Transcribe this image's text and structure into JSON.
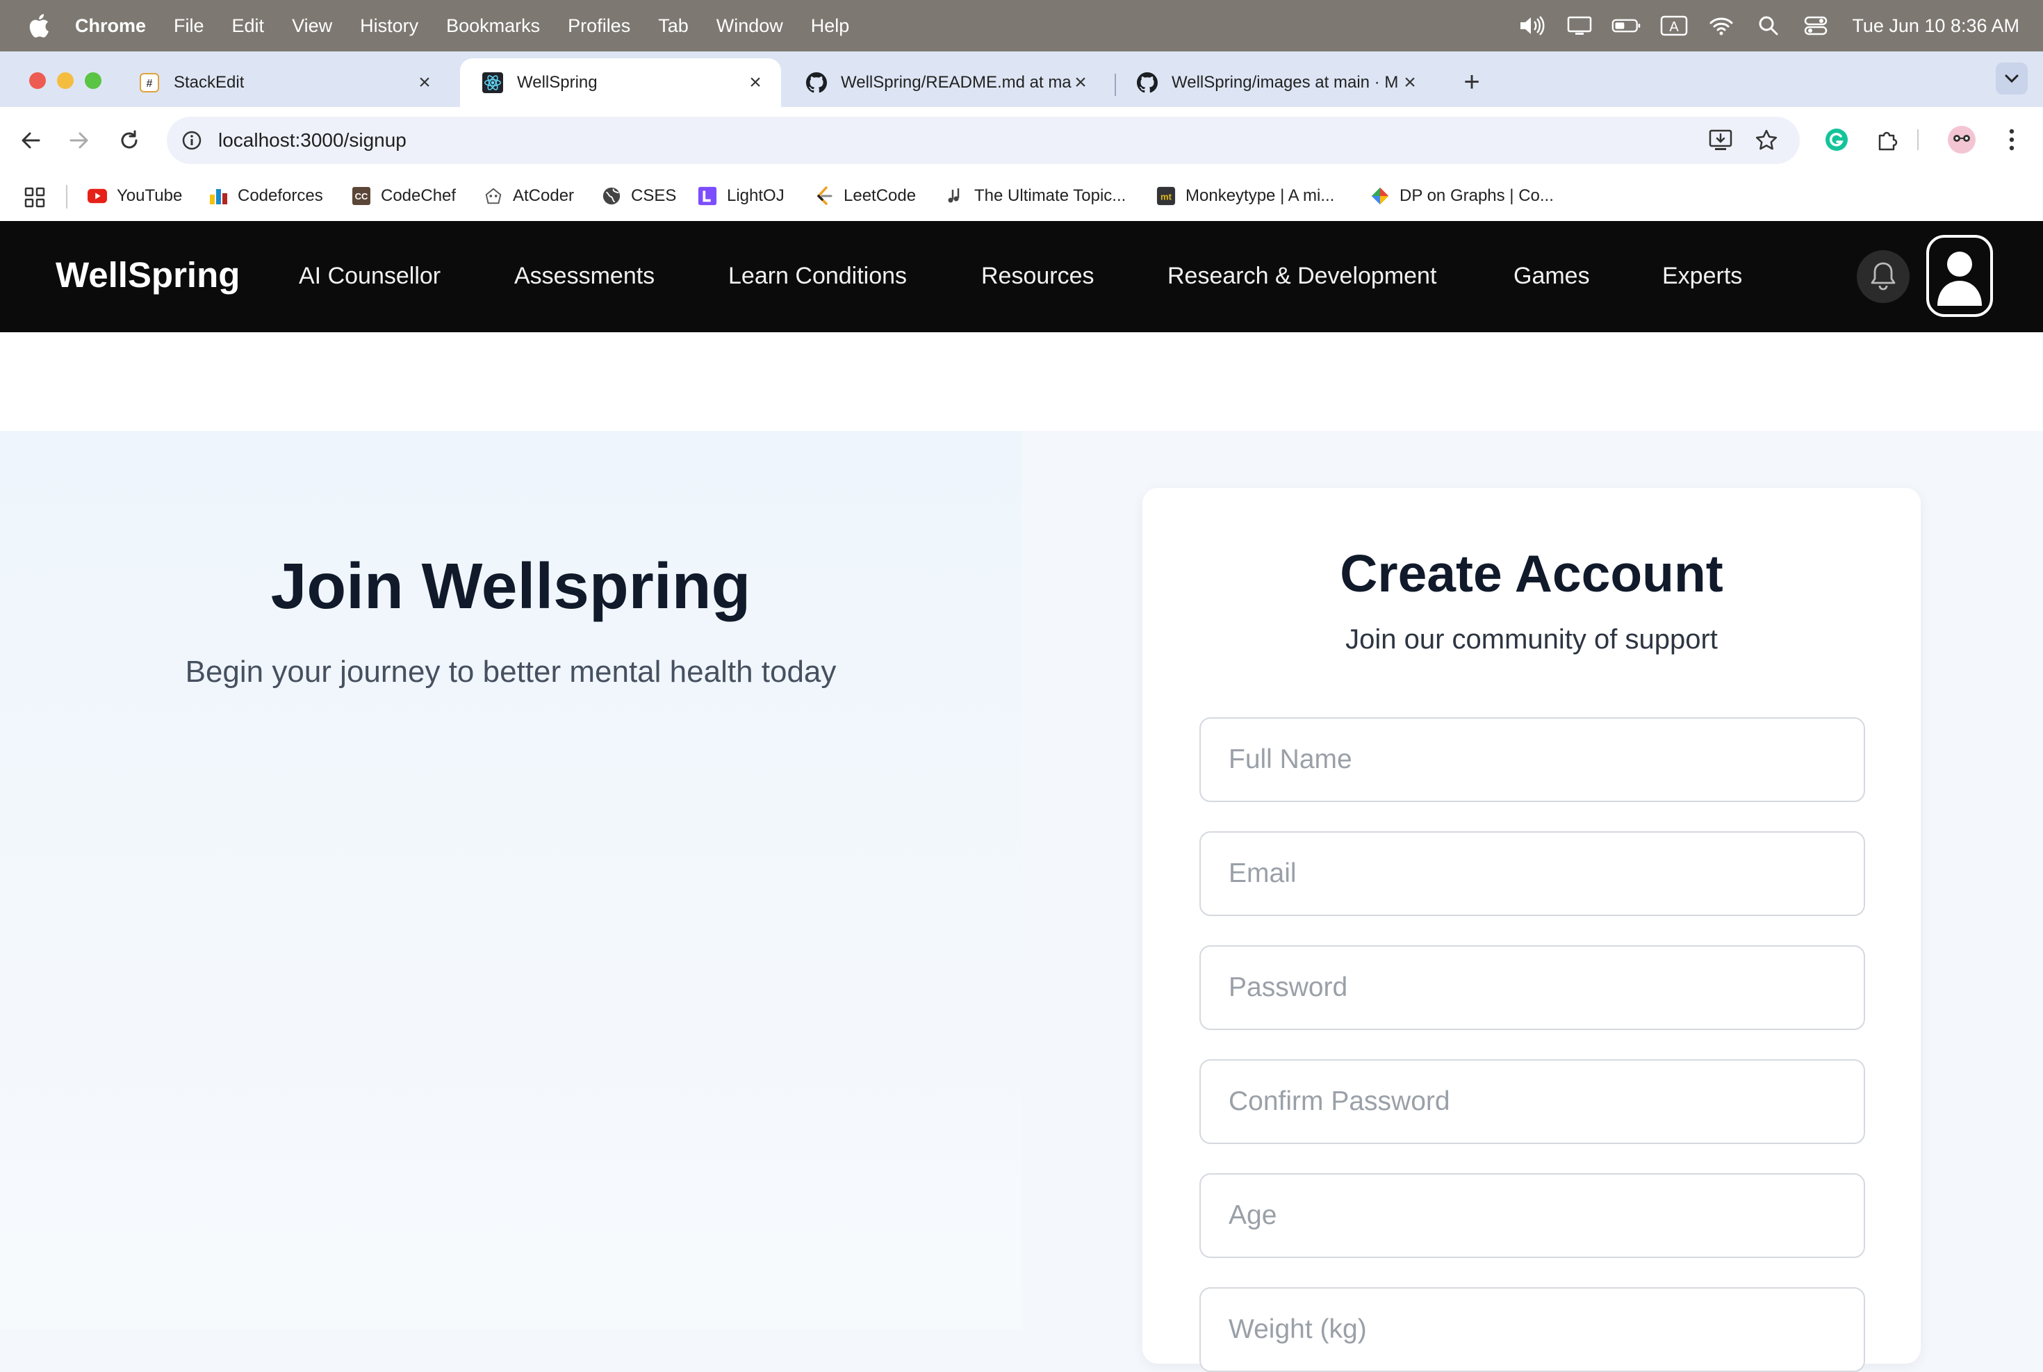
{
  "menubar": {
    "app_name": "Chrome",
    "items": [
      "File",
      "Edit",
      "View",
      "History",
      "Bookmarks",
      "Profiles",
      "Tab",
      "Window",
      "Help"
    ],
    "clock": "Tue Jun 10  8:36 AM"
  },
  "tabs": [
    {
      "title": "StackEdit",
      "icon": "stackedit-icon",
      "active": false
    },
    {
      "title": "WellSpring",
      "icon": "react-icon",
      "active": true
    },
    {
      "title": "WellSpring/README.md at ma",
      "icon": "github-icon",
      "active": false
    },
    {
      "title": "WellSpring/images at main · M",
      "icon": "github-icon",
      "active": false
    }
  ],
  "toolbar": {
    "url": "localhost:3000/signup"
  },
  "bookmarks": [
    {
      "label": "YouTube",
      "icon": "youtube-icon",
      "color": "#e62117"
    },
    {
      "label": "Codeforces",
      "icon": "codeforces-icon",
      "color": "#1a8ad0"
    },
    {
      "label": "CodeChef",
      "icon": "codechef-icon",
      "color": "#5b4638"
    },
    {
      "label": "AtCoder",
      "icon": "atcoder-icon",
      "color": "#555555"
    },
    {
      "label": "CSES",
      "icon": "globe-icon",
      "color": "#444444"
    },
    {
      "label": "LightOJ",
      "icon": "lightoj-icon",
      "color": "#7c4dff"
    },
    {
      "label": "LeetCode",
      "icon": "leetcode-icon",
      "color": "#f0a020"
    },
    {
      "label": "The Ultimate Topic...",
      "icon": "music-note-icon",
      "color": "#444444"
    },
    {
      "label": "Monkeytype | A mi...",
      "icon": "monkeytype-icon",
      "color": "#e2b714"
    },
    {
      "label": "DP on Graphs | Co...",
      "icon": "diamond-icon",
      "color": "#34a853"
    }
  ],
  "site": {
    "brand": "WellSpring",
    "nav": [
      "AI Counsellor",
      "Assessments",
      "Learn Conditions",
      "Resources",
      "Research & Development",
      "Games",
      "Experts"
    ]
  },
  "hero": {
    "title": "Join Wellspring",
    "subtitle": "Begin your journey to better mental health today"
  },
  "signup_form": {
    "title": "Create Account",
    "subtitle": "Join our community of support",
    "fields": [
      {
        "placeholder": "Full Name",
        "value": ""
      },
      {
        "placeholder": "Email",
        "value": ""
      },
      {
        "placeholder": "Password",
        "value": ""
      },
      {
        "placeholder": "Confirm Password",
        "value": ""
      },
      {
        "placeholder": "Age",
        "value": ""
      },
      {
        "placeholder": "Weight (kg)",
        "value": ""
      }
    ]
  }
}
